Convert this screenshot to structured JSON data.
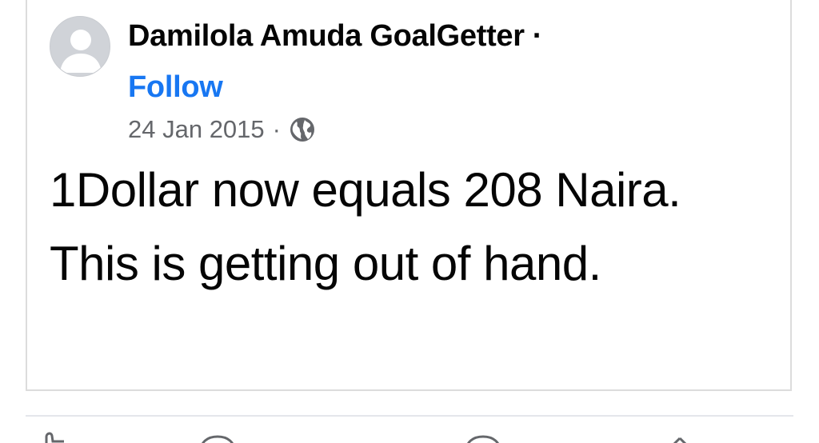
{
  "post": {
    "author_name": "Damilola Amuda GoalGetter",
    "separator": "·",
    "follow_label": "Follow",
    "date": "24 Jan 2015",
    "meta_separator": "·",
    "privacy_icon": "globe-icon",
    "text": "1Dollar now equals 208 Naira. This is getting out of hand."
  },
  "avatar_icon": "default-avatar-icon",
  "colors": {
    "link": "#1877f2",
    "primary_text": "#050505",
    "secondary_text": "#65676b",
    "border": "#dcdcdc"
  },
  "action_bar": {
    "icons": [
      "like-icon",
      "comment-icon",
      "whatsapp-icon",
      "share-icon"
    ]
  }
}
